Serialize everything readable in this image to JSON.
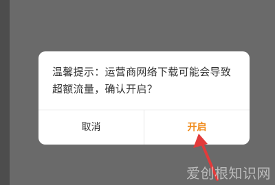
{
  "dialog": {
    "message": "温馨提示：运营商网络下载可能会导致超额流量，确认开启？",
    "cancel_label": "取消",
    "confirm_label": "开启",
    "confirm_color": "#f08a1a"
  },
  "annotation": {
    "arrow_color": "#e23b3b"
  },
  "watermark": {
    "text": "爱创根知识网"
  }
}
